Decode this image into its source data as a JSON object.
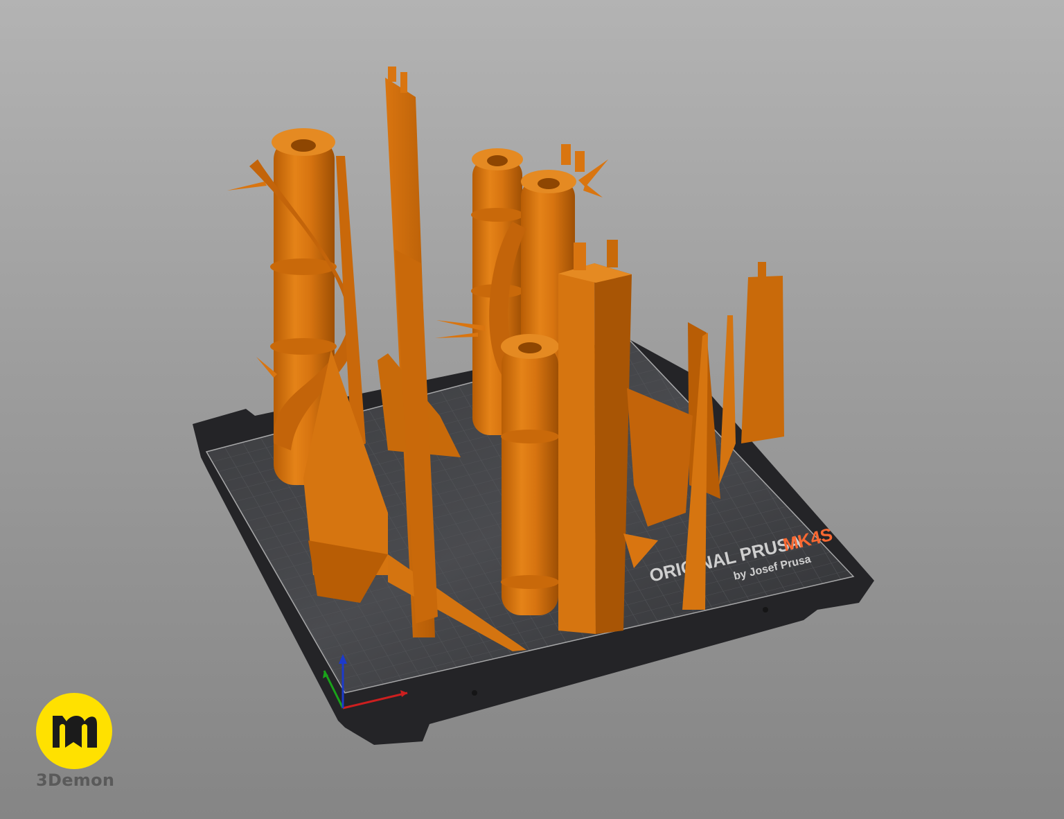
{
  "viewport": {
    "background_top": "#b3b3b3",
    "background_bottom": "#858585"
  },
  "printer": {
    "brand_prefix": "ORIGINAL PRUSA",
    "model": "MK4S",
    "tagline": "by Josef Prusa",
    "bed_color": "#2b2b2d",
    "accent_color": "#fa6831"
  },
  "model_color": "#e07a10",
  "axes": {
    "x_color": "#cc1f1f",
    "y_color": "#1aa31a",
    "z_color": "#1c3acc"
  },
  "watermark": {
    "icon": "3demon-m-icon",
    "label": "3Demon",
    "color": "#ffe100"
  }
}
